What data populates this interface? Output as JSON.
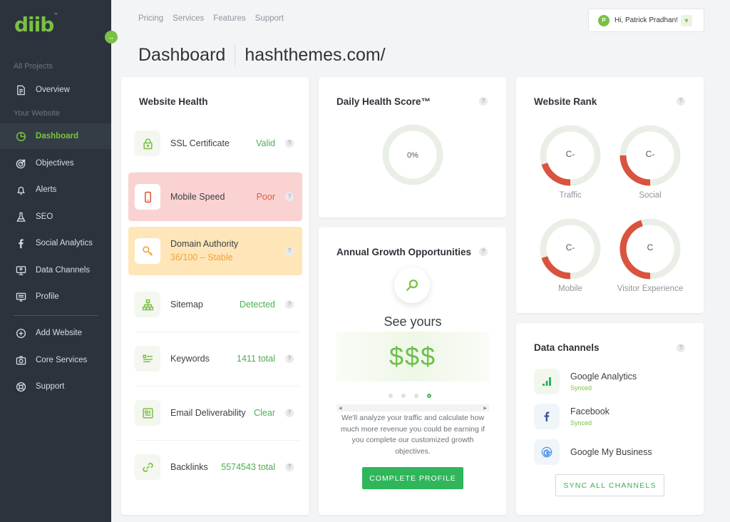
{
  "brand": {
    "logo": "diib",
    "tm": "™"
  },
  "sidebar": {
    "section_projects": "All Projects",
    "section_website": "Your Website",
    "items": [
      {
        "label": "Overview",
        "icon": "document-icon"
      },
      {
        "label": "Dashboard",
        "icon": "pie-chart-icon",
        "active": true
      },
      {
        "label": "Objectives",
        "icon": "target-icon"
      },
      {
        "label": "Alerts",
        "icon": "bell-icon"
      },
      {
        "label": "SEO",
        "icon": "flask-icon"
      },
      {
        "label": "Social Analytics",
        "icon": "facebook-icon"
      },
      {
        "label": "Data Channels",
        "icon": "monitor-user-icon"
      },
      {
        "label": "Profile",
        "icon": "id-card-icon"
      }
    ],
    "bottom_items": [
      {
        "label": "Add Website",
        "icon": "plus-circle-icon"
      },
      {
        "label": "Core Services",
        "icon": "camera-icon"
      },
      {
        "label": "Support",
        "icon": "lifebuoy-icon"
      }
    ]
  },
  "topnav": {
    "links": [
      "Pricing",
      "Services",
      "Features",
      "Support"
    ]
  },
  "user": {
    "initial": "P",
    "greeting": "Hi, Patrick Pradhan!"
  },
  "page": {
    "title": "Dashboard",
    "site": "hashthemes.com/"
  },
  "website_health": {
    "title": "Website Health",
    "rows": [
      {
        "label": "SSL Certificate",
        "value": "Valid",
        "icon": "lock-icon",
        "state": "ok"
      },
      {
        "label": "Mobile Speed",
        "value": "Poor",
        "icon": "mobile-icon",
        "state": "poor"
      },
      {
        "label": "Domain Authority",
        "value": "36/100 – Stable",
        "icon": "key-icon",
        "state": "warn"
      },
      {
        "label": "Sitemap",
        "value": "Detected",
        "icon": "sitemap-icon",
        "state": "ok"
      },
      {
        "label": "Keywords",
        "value": "1411 total",
        "icon": "keywords-icon",
        "state": "ok"
      },
      {
        "label": "Email Deliverability",
        "value": "Clear",
        "icon": "email-icon",
        "state": "ok"
      },
      {
        "label": "Backlinks",
        "value": "5574543 total",
        "icon": "link-icon",
        "state": "ok"
      }
    ]
  },
  "daily_health": {
    "title": "Daily Health Score™",
    "value": "0%",
    "fraction": 0
  },
  "growth": {
    "title": "Annual Growth Opportunities",
    "headline": "See yours",
    "money": "$$$",
    "description": "We'll analyze your traffic and calculate how much more revenue you could be earning if you complete our customized growth objectives.",
    "button": "COMPLETE PROFILE",
    "active_dot": 3,
    "dot_count": 4
  },
  "website_rank": {
    "title": "Website Rank",
    "items": [
      {
        "label": "Traffic",
        "grade": "C-",
        "fraction": 0.2
      },
      {
        "label": "Social",
        "grade": "C-",
        "fraction": 0.25
      },
      {
        "label": "Mobile",
        "grade": "C-",
        "fraction": 0.2
      },
      {
        "label": "Visitor Experience",
        "grade": "C",
        "fraction": 0.45
      }
    ],
    "colors": {
      "track": "#e9efe6",
      "fill": "#d9533f"
    }
  },
  "data_channels": {
    "title": "Data channels",
    "items": [
      {
        "name": "Google Analytics",
        "status": "Synced",
        "icon": "analytics-icon"
      },
      {
        "name": "Facebook",
        "status": "Synced",
        "icon": "facebook-icon"
      },
      {
        "name": "Google My Business",
        "status": "",
        "icon": "google-icon"
      }
    ],
    "button": "SYNC ALL CHANNELS"
  },
  "colors": {
    "accent": "#7ac143",
    "sidebar": "#2c333d",
    "success": "#2fb65a",
    "danger": "#e45a3a"
  }
}
